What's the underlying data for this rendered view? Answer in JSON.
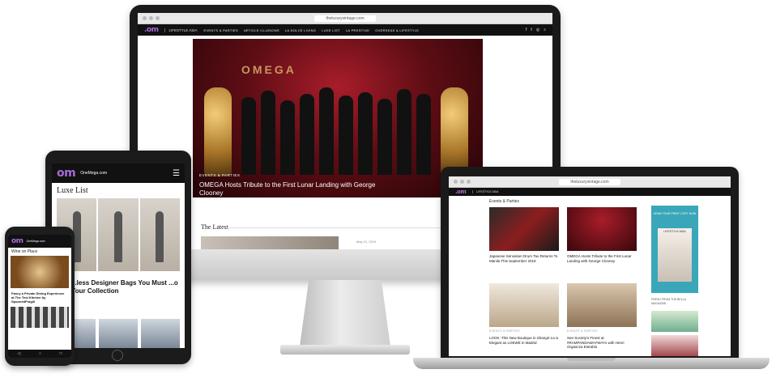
{
  "desktop": {
    "url": "theluxuryvintage.com",
    "brand_sub": "LIFESTYLE ASIA",
    "nav": [
      "EVENTS & PARTIES",
      "ARTICLE ILLUSIONS",
      "LA DOLCE LIVING",
      "LUXE LIST",
      "LA PRESTIGE",
      "OVERSEAS & LIFESTYLE"
    ],
    "nav_icons": [
      "f",
      "t",
      "◎",
      "⌕"
    ],
    "hero_tag": "EVENTS & PARTIES",
    "hero_banner": "OMEGA",
    "hero_headline": "OMEGA Hosts Tribute to the First Lunar Landing with George Clooney",
    "latest_label": "The Latest",
    "latest_meta": "May 21, 2019"
  },
  "tablet": {
    "logo": "om",
    "site": "OneMega.com",
    "menu_icon": "☰",
    "section_title": "Luxe List",
    "headline": "...less Designer Bags You Must ...o Your Collection"
  },
  "phone": {
    "logo": "om",
    "site": "OneMega.com",
    "section_title": "Wine on Place",
    "headline": "Fancy a Private Dining Experience at The Test Kitchen by SpoonedFragili",
    "nav": [
      "◁",
      "○",
      "□"
    ]
  },
  "laptop": {
    "url": "theluxuryvintage.com",
    "section": "Events & Parties",
    "cards": [
      {
        "text": "Japanese Sensation Drum Tao Returns To Manila This September 2019",
        "cat": "EVENTS & PARTIES"
      },
      {
        "text": "OMEGA Hosts Tribute to the First Lunar Landing with George Clooney",
        "cat": "EVENTS & PARTIES"
      },
      {
        "text": "LOOK: This New Boutique in Shangri-La is Elegant as LOEWE in Madrid",
        "cat": "EVENTS & PARTIES"
      },
      {
        "text": "See Society's Finest at #RAMPANDAWAYWAYs with Henri Orgasnza Estrablo",
        "cat": "EVENTS & PARTIES"
      }
    ],
    "ad_text": "GRAB YOUR PRINT COPY NOW",
    "ad_mag": "LIFESTYLE ASIA",
    "side_title": "FRESH FROM THE BELLA MAGAZINE"
  },
  "colors": {
    "logo_purple": "#a86bd6",
    "accent_teal": "#25a7a5",
    "hero_red": "#a81d2a",
    "nav_black": "#111111"
  }
}
